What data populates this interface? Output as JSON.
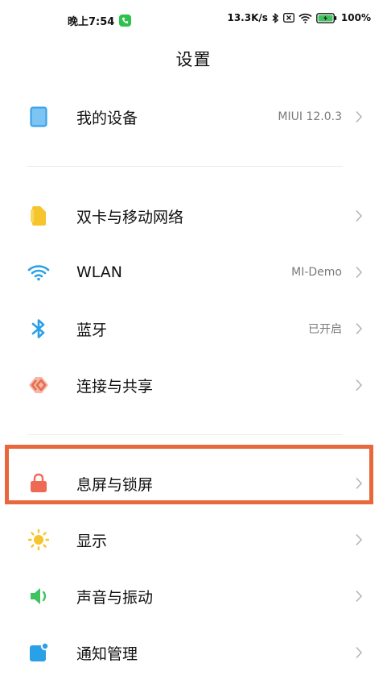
{
  "status_bar": {
    "time": "晚上7:54",
    "net_speed": "13.3K/s",
    "battery": "100%",
    "icons": [
      "call-icon",
      "bluetooth-icon",
      "sim-disabled-icon",
      "wifi-icon",
      "battery-charging-icon"
    ]
  },
  "page": {
    "title": "设置"
  },
  "items": [
    {
      "label": "我的设备",
      "value": "MIUI 12.0.3",
      "icon": "tablet-icon",
      "color": "#3ba3ea"
    },
    {
      "label": "双卡与移动网络",
      "value": "",
      "icon": "sim-card-icon",
      "color": "#f6c42c"
    },
    {
      "label": "WLAN",
      "value": "MI-Demo",
      "icon": "wifi-icon",
      "color": "#2aa0e6"
    },
    {
      "label": "蓝牙",
      "value": "已开启",
      "icon": "bluetooth-icon",
      "color": "#2aa0e6"
    },
    {
      "label": "连接与共享",
      "value": "",
      "icon": "share-icon",
      "color": "#e66e4e"
    },
    {
      "label": "息屏与锁屏",
      "value": "",
      "icon": "lock-icon",
      "color": "#ee6a55"
    },
    {
      "label": "显示",
      "value": "",
      "icon": "sun-icon",
      "color": "#f6c42c"
    },
    {
      "label": "声音与振动",
      "value": "",
      "icon": "speaker-icon",
      "color": "#3ec35e"
    },
    {
      "label": "通知管理",
      "value": "",
      "icon": "notification-icon",
      "color": "#2aa0e6"
    }
  ],
  "highlight_color": "#e8673d"
}
